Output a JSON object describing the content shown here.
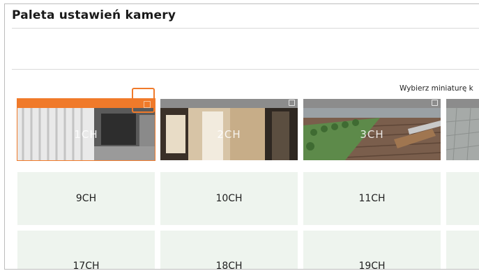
{
  "title": "Paleta ustawień kamery",
  "hint": "Wybierz miniaturę k",
  "channels": {
    "row1": [
      "1CH",
      "2CH",
      "3CH"
    ],
    "row2": [
      "9CH",
      "10CH",
      "11CH"
    ],
    "row3": [
      "17CH",
      "18CH",
      "19CH"
    ]
  },
  "colors": {
    "accent": "#f07a2a",
    "empty_tile": "#eef4ee",
    "tile_bar": "#8c8c8c"
  },
  "icons": {
    "settings": "camera-settings-icon"
  }
}
